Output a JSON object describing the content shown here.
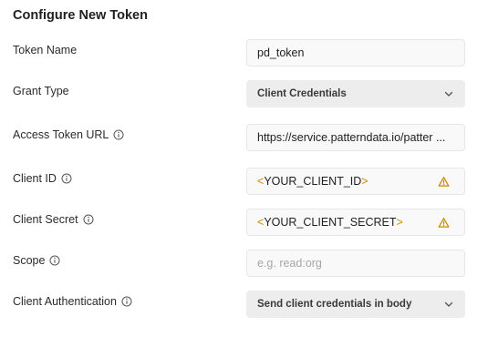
{
  "title": "Configure New Token",
  "fields": {
    "token_name": {
      "label": "Token Name",
      "value": "pd_token"
    },
    "grant_type": {
      "label": "Grant Type",
      "value": "Client Credentials"
    },
    "access_token_url": {
      "label": "Access Token URL",
      "value": "https://service.patterndata.io/patter ..."
    },
    "client_id": {
      "label": "Client ID",
      "open": "<",
      "var": "YOUR_CLIENT_ID",
      "close": ">"
    },
    "client_secret": {
      "label": "Client Secret",
      "open": "<",
      "var": "YOUR_CLIENT_SECRET",
      "close": ">"
    },
    "scope": {
      "label": "Scope",
      "placeholder": "e.g. read:org"
    },
    "client_authentication": {
      "label": "Client Authentication",
      "value": "Send client credentials in body"
    }
  },
  "colors": {
    "variable_bracket": "#c78a00",
    "warning": "#c78a00"
  }
}
